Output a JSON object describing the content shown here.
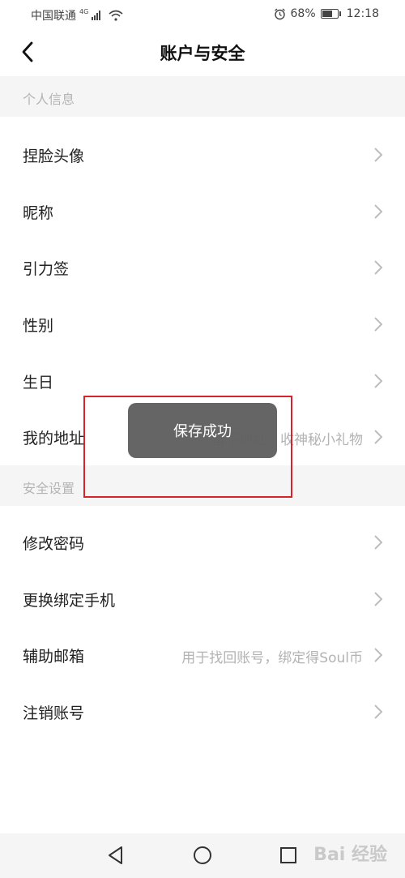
{
  "status_bar": {
    "carrier": "中国联通",
    "network": "4G",
    "battery": "68%",
    "battery_level": 0.68,
    "time": "12:18"
  },
  "header": {
    "title": "账户与安全",
    "back_icon": "chevron-left-icon"
  },
  "sections": {
    "personal": {
      "title": "个人信息",
      "items": [
        {
          "label": "捏脸头像",
          "value": ""
        },
        {
          "label": "昵称",
          "value": ""
        },
        {
          "label": "引力签",
          "value": ""
        },
        {
          "label": "性别",
          "value": ""
        },
        {
          "label": "生日",
          "value": ""
        },
        {
          "label": "我的地址",
          "value": "留下地址，收神秘小礼物"
        }
      ]
    },
    "security": {
      "title": "安全设置",
      "items": [
        {
          "label": "修改密码",
          "value": ""
        },
        {
          "label": "更换绑定手机",
          "value": ""
        },
        {
          "label": "辅助邮箱",
          "value": "用于找回账号，绑定得Soul币"
        },
        {
          "label": "注销账号",
          "value": ""
        }
      ]
    }
  },
  "toast": {
    "message": "保存成功"
  },
  "highlight_color": "#d8232a",
  "nav_bar": {
    "back_icon": "triangle-back-icon",
    "home_icon": "circle-home-icon",
    "recents_icon": "square-recents-icon"
  },
  "watermark": "Bai 经验"
}
